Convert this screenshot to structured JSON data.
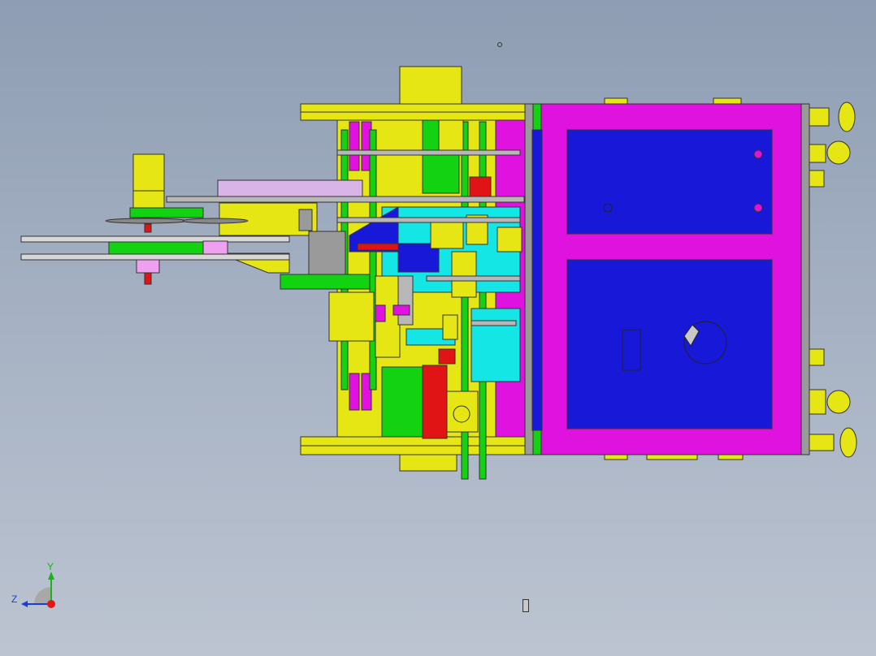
{
  "viewport": {
    "background_top": "#8e9db3",
    "background_bottom": "#bcc4d1"
  },
  "triad": {
    "y_label": "Y",
    "z_label": "Z",
    "y_color": "#18b418",
    "z_color": "#1e3cdc",
    "x_color": "#e01818"
  },
  "colors": {
    "frame_magenta": "#e012e0",
    "panel_blue": "#1818d8",
    "yellow": "#e6e614",
    "green": "#12d212",
    "cyan": "#14e6e6",
    "red": "#e01414",
    "gray": "#9a9a9a",
    "light_purple": "#d8b4e8"
  },
  "icons": [
    "coordinate-triad-icon",
    "origin-marker-icon",
    "small-component-icon"
  ]
}
